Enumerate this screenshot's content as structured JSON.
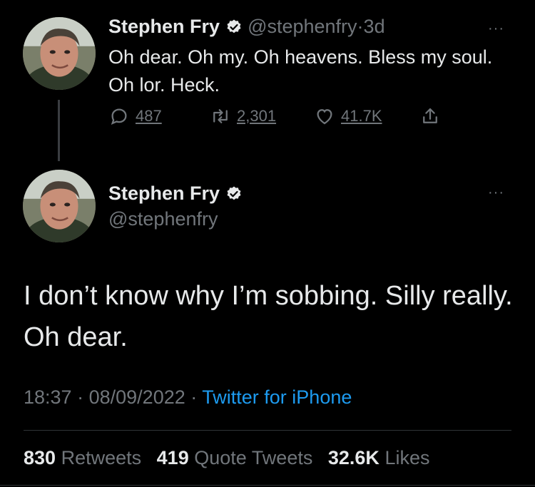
{
  "tweet1": {
    "name": "Stephen Fry",
    "handle": "@stephenfry",
    "separator": "·",
    "age": "3d",
    "text": "Oh dear. Oh my. Oh heavens. Bless my soul. Oh lor. Heck.",
    "replies": "487",
    "retweets": "2,301",
    "likes": "41.7K"
  },
  "tweet2": {
    "name": "Stephen Fry",
    "handle": "@stephenfry",
    "text": "I don’t know why I’m sobbing. Silly really. Oh dear.",
    "time": "18:37",
    "sep1": "·",
    "date": "08/09/2022",
    "sep2": "·",
    "source": "Twitter for iPhone"
  },
  "stats": {
    "retweets_count": "830",
    "retweets_label": "Retweets",
    "quotes_count": "419",
    "quotes_label": "Quote Tweets",
    "likes_count": "32.6K",
    "likes_label": "Likes"
  },
  "more_glyph": "···",
  "colors": {
    "background": "#000000",
    "text": "#e7e9ea",
    "muted": "#71767b",
    "link": "#1d9bf0"
  }
}
